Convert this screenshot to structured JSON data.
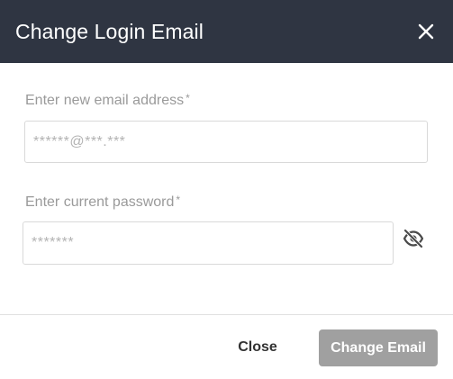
{
  "dialog": {
    "title": "Change Login Email",
    "close_icon": "close-icon"
  },
  "form": {
    "email": {
      "label": "Enter new email address",
      "required_mark": "*",
      "placeholder": "******@***.***",
      "value": ""
    },
    "password": {
      "label": "Enter current password",
      "required_mark": "*",
      "placeholder": "*******",
      "value": "",
      "visibility_icon": "eye-off-icon"
    }
  },
  "footer": {
    "close_label": "Close",
    "submit_label": "Change Email"
  },
  "colors": {
    "header_bg": "#2f3542",
    "primary_disabled": "#a0a0a0"
  }
}
